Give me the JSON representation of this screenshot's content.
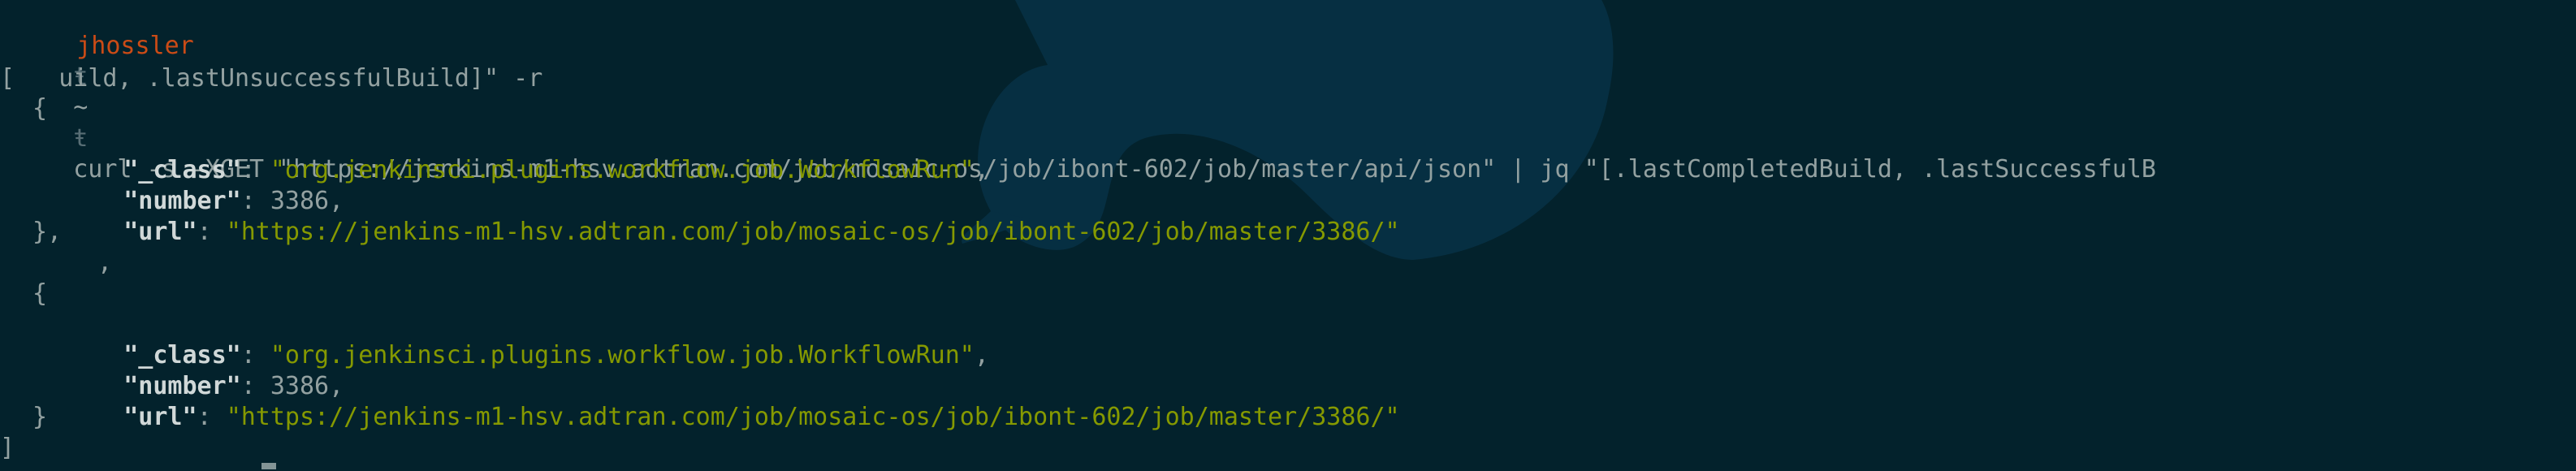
{
  "prompt": {
    "user": "jhossler",
    "sep1": "ŧ",
    "dir": "~",
    "sep2": "ŧ",
    "command_line1": "curl -s -XGET \"https://jenkins-m1-hsv.adtran.com/job/mosaic-os/job/ibont-602/job/master/api/json\" | jq \"[.lastCompletedBuild, .lastSuccessfulB",
    "command_line2": "uild, .lastUnsuccessfulBuild]\" -r"
  },
  "output": {
    "open_bracket": "[",
    "close_bracket": "]",
    "builds": [
      {
        "open_brace": "{",
        "class_key": "\"_class\"",
        "class_value": "\"org.jenkinsci.plugins.workflow.job.WorkflowRun\"",
        "number_key": "\"number\"",
        "number_value": "3386",
        "url_key": "\"url\"",
        "url_value": "\"https://jenkins-m1-hsv.adtran.com/job/mosaic-os/job/ibont-602/job/master/3386/\"",
        "close_brace": "},"
      },
      {
        "open_brace": "{",
        "class_key": "\"_class\"",
        "class_value": "\"org.jenkinsci.plugins.workflow.job.WorkflowRun\"",
        "number_key": "\"number\"",
        "number_value": "3386",
        "url_key": "\"url\"",
        "url_value": "\"https://jenkins-m1-hsv.adtran.com/job/mosaic-os/job/ibont-602/job/master/3386/\"",
        "close_brace": "}"
      }
    ],
    "separator_comma": ","
  },
  "colors": {
    "background": "#03222c",
    "user": "#cb4b16",
    "string": "#859900",
    "key": "#d0d8d8",
    "text": "#93a1a1"
  }
}
